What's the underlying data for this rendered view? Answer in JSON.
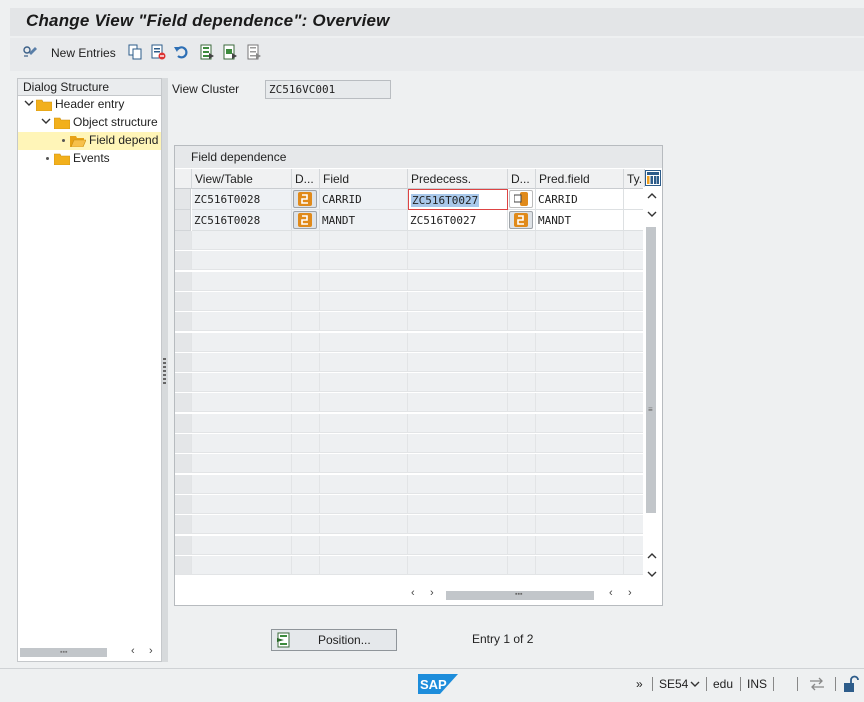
{
  "window": {
    "title": "Change View \"Field dependence\": Overview"
  },
  "toolbar": {
    "new_entries_label": "New Entries",
    "icons": [
      "display-change-icon",
      "copy-icon",
      "delete-icon",
      "undo-icon",
      "select-all-icon",
      "select-block-icon",
      "deselect-all-icon"
    ]
  },
  "dialog_structure": {
    "header": "Dialog Structure",
    "items": [
      {
        "label": "Header entry",
        "level": 0,
        "expanded": true
      },
      {
        "label": "Object structure",
        "level": 1,
        "expanded": true
      },
      {
        "label": "Field depend",
        "level": 2,
        "selected": true
      },
      {
        "label": "Events",
        "level": 1
      }
    ]
  },
  "view_cluster": {
    "label": "View Cluster",
    "value": "ZC516VC001"
  },
  "table": {
    "title": "Field dependence",
    "columns": [
      "View/Table",
      "D...",
      "Field",
      "Predecess.",
      "D...",
      "Pred.field",
      "Ty."
    ],
    "rows": [
      [
        "ZC516T0028",
        "",
        "CARRID",
        "ZC516T0027",
        "",
        "CARRID",
        ""
      ],
      [
        "ZC516T0028",
        "",
        "MANDT",
        "ZC516T0027",
        "",
        "MANDT",
        ""
      ]
    ]
  },
  "position_button": {
    "label": "Position..."
  },
  "entry_info": "Entry 1 of 2",
  "status_bar": {
    "chevrons": "»",
    "transaction": "SE54",
    "user": "edu",
    "mode": "INS"
  },
  "colors": {
    "selection_yellow": "#fff5b8",
    "folder_orange": "#f2b01c",
    "sap_blue": "#1d8ddb"
  }
}
